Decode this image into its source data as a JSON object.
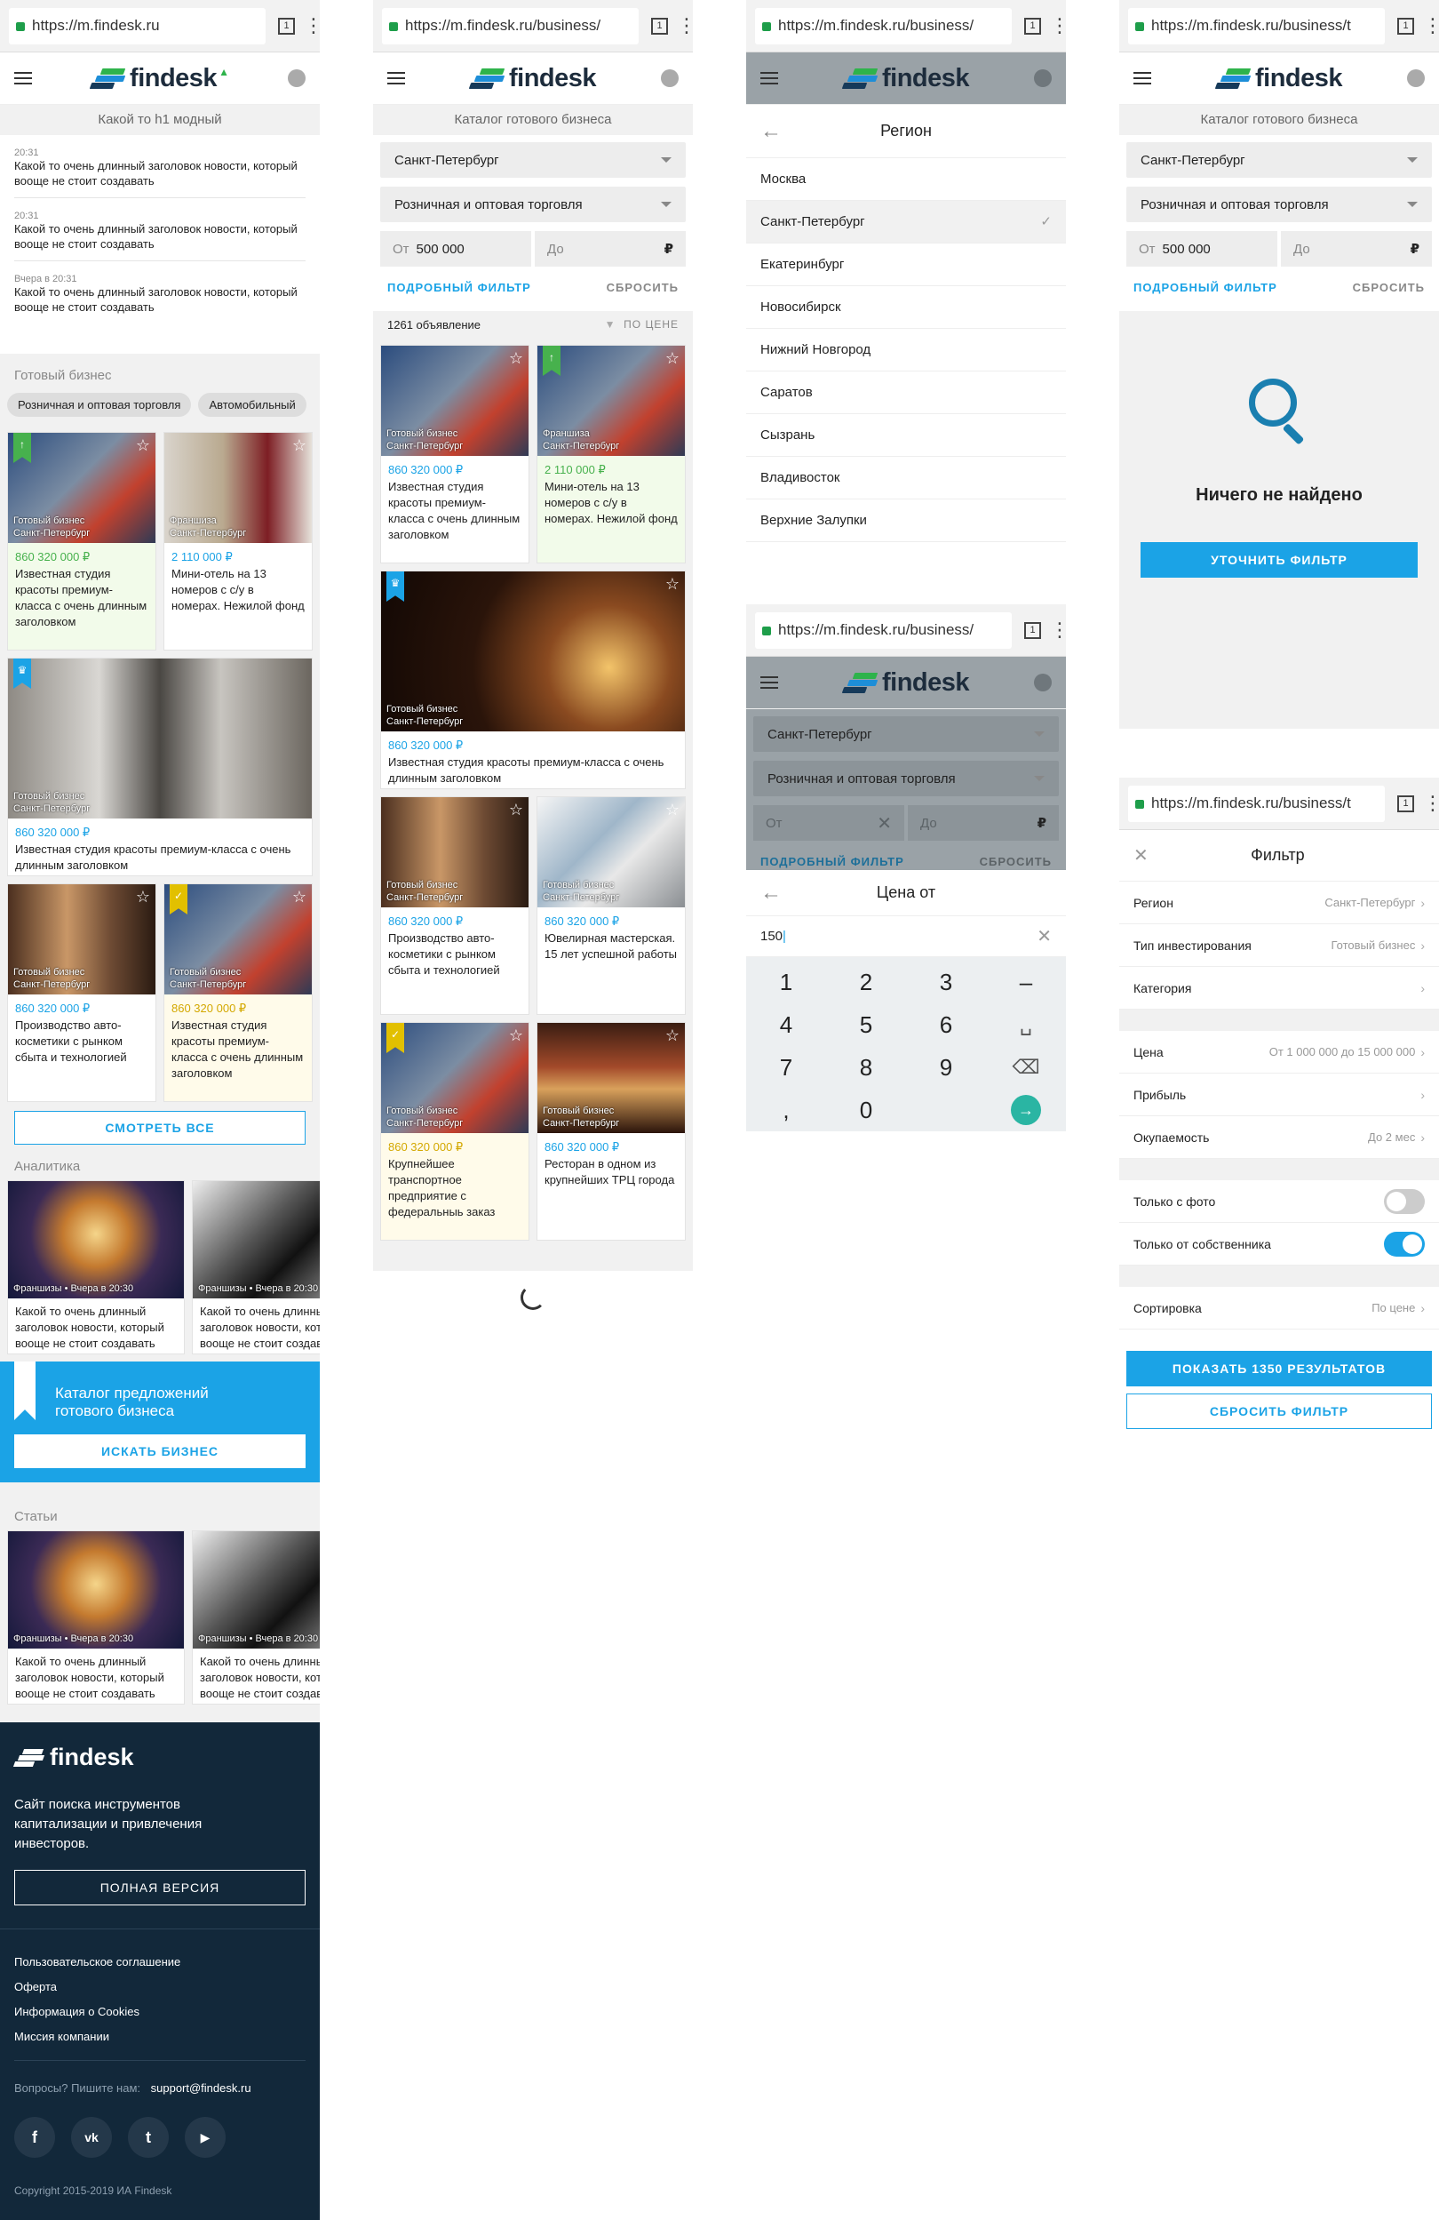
{
  "s1": {
    "url": "https://m.findesk.ru",
    "tabs": "1",
    "logo": "findesk",
    "sub": "Какой то h1 модный",
    "news": [
      {
        "time": "20:31",
        "text": "Какой то очень длинный заголовок новости, который вооще не стоит создавать"
      },
      {
        "time": "20:31",
        "text": "Какой то очень длинный заголовок новости, который вооще не стоит создавать"
      },
      {
        "time": "Вчера в 20:31",
        "text": "Какой то очень длинный заголовок новости, который вооще не стоит создавать"
      }
    ],
    "section_business": "Готовый бизнес",
    "chips": [
      "Розничная и оптовая торговля",
      "Автомобильный"
    ],
    "cards": [
      {
        "cat": "Готовый бизнес",
        "city": "Санкт-Петербург",
        "price": "860 320 000 ₽",
        "text": "Известная студия красоты премиум-класса с очень длинным заголовком"
      },
      {
        "cat": "Франшиза",
        "city": "Санкт-Петербург",
        "price": "2 110 000 ₽",
        "text": "Мини-отель на 13 номеров с с/у в номерах. Нежилой фонд"
      },
      {
        "cat": "Готовый бизнес",
        "city": "Санкт-Петербург",
        "price": "860 320 000 ₽",
        "text": "Известная студия красоты премиум-класса с очень длинным заголовком"
      },
      {
        "cat": "Готовый бизнес",
        "city": "Санкт-Петербург",
        "price": "860 320 000 ₽",
        "text": "Производство авто-косметики с рынком сбыта и технологией"
      },
      {
        "cat": "Готовый бизнес",
        "city": "Санкт-Петербург",
        "price": "860 320 000 ₽",
        "text": "Известная студия красоты премиум-класса с очень длинным заголовком"
      }
    ],
    "see_all": "СМОТРЕТЬ ВСЕ",
    "section_analytics": "Аналитика",
    "analytics": [
      {
        "meta": "Франшизы • Вчера в 20:30",
        "text": "Какой то очень длинный заголовок новости, который вооще не стоит создавать"
      },
      {
        "meta": "Франшизы • Вчера в 20:30",
        "text": "Какой то очень длинный заголовок новости, который вооще не стоит создавать"
      }
    ],
    "promo_title": "Каталог предложений готового бизнеса",
    "promo_button": "ИСКАТЬ БИЗНЕС",
    "section_articles": "Статьи",
    "articles": [
      {
        "meta": "Франшизы • Вчера в 20:30",
        "text": "Какой то очень длинный заголовок новости, который вооще не стоит создавать"
      },
      {
        "meta": "Франшизы • Вчера в 20:30",
        "text": "Какой то очень длинный заголовок новости, который вооще не стоит создавать"
      }
    ],
    "footer_text": "Сайт поиска инструментов капитализации и привлечения инвесторов.",
    "full_version": "ПОЛНАЯ ВЕРСИЯ",
    "footer_links": [
      "Пользовательское соглашение",
      "Оферта",
      "Информация о Cookies",
      "Миссия компании"
    ],
    "questions": "Вопросы? Пишите нам:",
    "email": "support@findesk.ru",
    "copyright": "Copyright 2015-2019 ИА Findesk"
  },
  "s2": {
    "url": "https://m.findesk.ru/business/",
    "tabs": "1",
    "sub": "Каталог готового бизнеса",
    "city": "Санкт-Петербург",
    "category": "Розничная и оптовая торговля",
    "from_label": "От",
    "from_value": "500 000",
    "to_label": "До",
    "currency": "₽",
    "detailed": "ПОДРОБНЫЙ ФИЛЬТР",
    "reset": "СБРОСИТЬ",
    "count": "1261 объявление",
    "sort": "ПО ЦЕНЕ",
    "cards": [
      {
        "cat": "Готовый бизнес",
        "city": "Санкт-Петербург",
        "price": "860 320 000 ₽",
        "text": "Известная студия красоты премиум-класса с очень длинным заголовком"
      },
      {
        "cat": "Франшиза",
        "city": "Санкт-Петербург",
        "price": "2 110 000 ₽",
        "text": "Мини-отель на 13 номеров с с/у в номерах. Нежилой фонд"
      },
      {
        "cat": "Готовый бизнес",
        "city": "Санкт-Петербург",
        "price": "860 320 000 ₽",
        "text": "Известная студия красоты премиум-класса с очень длинным заголовком"
      },
      {
        "cat": "Готовый бизнес",
        "city": "Санкт-Петербург",
        "price": "860 320 000 ₽",
        "text": "Производство авто-косметики с рынком сбыта и технологией"
      },
      {
        "cat": "Готовый бизнес",
        "city": "Санкт-Петербург",
        "price": "860 320 000 ₽",
        "text": "Ювелирная мастерская. 15 лет успешной работы"
      },
      {
        "cat": "Готовый бизнес",
        "city": "Санкт-Петербург",
        "price": "860 320 000 ₽",
        "text": "Крупнейшее транспортное предприятие с федеральныь заказ"
      },
      {
        "cat": "Готовый бизнес",
        "city": "Санкт-Петербург",
        "price": "860 320 000 ₽",
        "text": "Ресторан в одном из крупнейших ТРЦ города"
      }
    ]
  },
  "s3": {
    "url": "https://m.findesk.ru/business/",
    "tabs": "1",
    "title": "Регион",
    "regions": [
      "Москва",
      "Санкт-Петербург",
      "Екатеринбург",
      "Новосибирск",
      "Нижний Новгород",
      "Саратов",
      "Сызрань",
      "Владивосток",
      "Верхние Залупки"
    ],
    "selected": "Санкт-Петербург"
  },
  "s4": {
    "url": "https://m.findesk.ru/business/",
    "tabs": "1",
    "city": "Санкт-Петербург",
    "category": "Розничная и оптовая торговля",
    "from_label": "От",
    "to_label": "До",
    "currency": "₽",
    "detailed": "ПОДРОБНЫЙ ФИЛЬТР",
    "reset": "СБРОСИТЬ",
    "title": "Цена от",
    "value": "150",
    "keys": [
      "1",
      "2",
      "3",
      "–",
      "4",
      "5",
      "6",
      "␣",
      "7",
      "8",
      "9",
      "⌫",
      ",",
      "0",
      "→"
    ]
  },
  "s5": {
    "url": "https://m.findesk.ru/business/t",
    "tabs": "1",
    "sub": "Каталог готового бизнеса",
    "city": "Санкт-Петербург",
    "category": "Розничная и оптовая торговля",
    "from_label": "От",
    "from_value": "500 000",
    "to_label": "До",
    "currency": "₽",
    "detailed": "ПОДРОБНЫЙ ФИЛЬТР",
    "reset": "СБРОСИТЬ",
    "empty": "Ничего не найдено",
    "refine": "УТОЧНИТЬ ФИЛЬТР"
  },
  "s6": {
    "url": "https://m.findesk.ru/business/t",
    "tabs": "1",
    "title": "Фильтр",
    "rows": [
      {
        "label": "Регион",
        "value": "Санкт-Петербург"
      },
      {
        "label": "Тип инвестирования",
        "value": "Готовый бизнес"
      },
      {
        "label": "Категория",
        "value": ""
      },
      {
        "label": "Цена",
        "value": "От 1 000 000 до 15 000 000"
      },
      {
        "label": "Прибыль",
        "value": ""
      },
      {
        "label": "Окупаемость",
        "value": "До 2 мес"
      }
    ],
    "photo_only": "Только с фото",
    "photo_only_on": false,
    "owner_only": "Только от собственника",
    "owner_only_on": true,
    "sort_label": "Сортировка",
    "sort_value": "По цене",
    "show": "ПОКАЗАТЬ 1350 РЕЗУЛЬТАТОВ",
    "reset": "СБРОСИТЬ ФИЛЬТР"
  },
  "colors": {
    "accent": "#1ba3e6",
    "green": "#47b14d",
    "gold": "#d4a800",
    "dark": "#12283a"
  }
}
